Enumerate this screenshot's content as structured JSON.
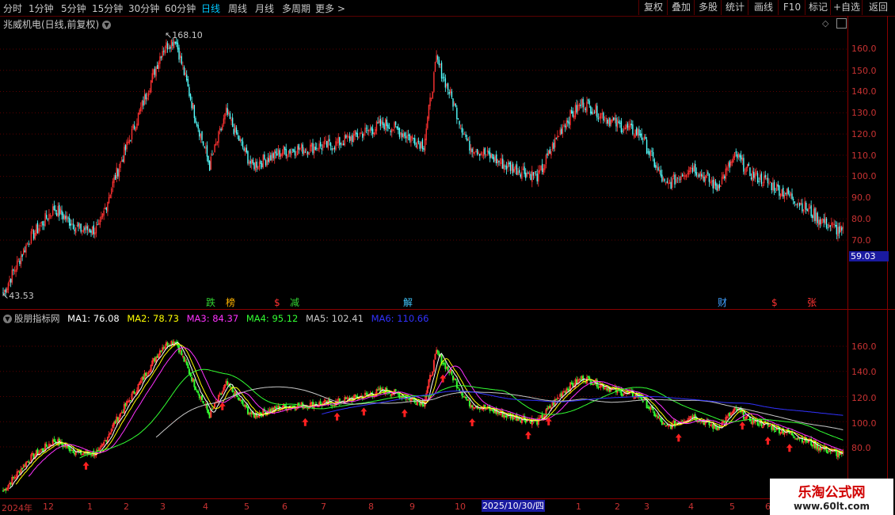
{
  "toolbar": {
    "timeframes": [
      "分时",
      "1分钟",
      "5分钟",
      "15分钟",
      "30分钟",
      "60分钟",
      "日线",
      "周线",
      "月线",
      "多周期",
      "更多 >"
    ],
    "active": "日线",
    "right_buttons": [
      "复权",
      "叠加",
      "多股",
      "统计",
      "画线",
      "F10",
      "标记",
      "+自选",
      "返回"
    ]
  },
  "main": {
    "title": "兆威机电(日线,前复权)",
    "high_label": "168.10",
    "low_label": "43.53",
    "price_ticks": [
      "160.0",
      "150.0",
      "140.0",
      "130.0",
      "120.0",
      "110.0",
      "100.0",
      "90.0",
      "80.0",
      "70.0"
    ],
    "last_price": "59.03",
    "events": [
      {
        "text": "跌",
        "color": "#32d232"
      },
      {
        "text": "榜",
        "color": "#ffb400"
      },
      {
        "text": "$",
        "color": "#ff3232"
      },
      {
        "text": "减",
        "color": "#32d232"
      },
      {
        "text": "解",
        "color": "#40c8ff"
      },
      {
        "text": "财",
        "color": "#40a0ff"
      },
      {
        "text": "$",
        "color": "#ff3232"
      },
      {
        "text": "张",
        "color": "#ff3232"
      }
    ]
  },
  "indicator": {
    "name": "股朋指标网",
    "ma": [
      {
        "label": "MA1: 76.08",
        "color": "#ffffff"
      },
      {
        "label": "MA2: 78.73",
        "color": "#ffff00"
      },
      {
        "label": "MA3: 84.37",
        "color": "#ff32ff"
      },
      {
        "label": "MA4: 95.12",
        "color": "#32ff32"
      },
      {
        "label": "MA5: 102.41",
        "color": "#c8c8c8"
      },
      {
        "label": "MA6: 110.66",
        "color": "#3232ff"
      }
    ],
    "ticks": [
      "160.0",
      "140.0",
      "120.0",
      "100.0",
      "80.0"
    ]
  },
  "xaxis": {
    "labels": [
      "2024年",
      "12",
      "1",
      "2",
      "3",
      "4",
      "5",
      "6",
      "7",
      "8",
      "9",
      "10",
      "1",
      "2",
      "3",
      "4",
      "5",
      "6"
    ],
    "cursor_date": "2025/10/30/四"
  },
  "watermark": {
    "line1": "乐淘公式网",
    "line2": "www.60lt.com"
  },
  "colors": {
    "up": "#ff3232",
    "down": "#54ffff",
    "ind_down": "#32ff32",
    "grid": "#8a0000",
    "arrow": "#ff2020"
  }
}
